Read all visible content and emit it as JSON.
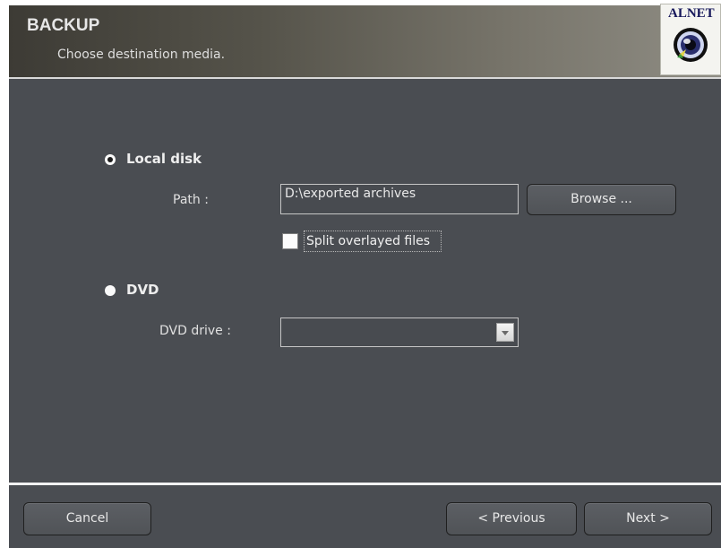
{
  "header": {
    "title": "BACKUP",
    "subtitle": "Choose destination media.",
    "logo_text": "ALNET"
  },
  "options": {
    "local_disk": {
      "label": "Local disk",
      "selected": true
    },
    "dvd": {
      "label": "DVD",
      "selected": false
    }
  },
  "local": {
    "path_label": "Path :",
    "path_value": "D:\\exported archives",
    "browse_label": "Browse ...",
    "split_label": "Split overlayed files",
    "split_checked": false
  },
  "dvd": {
    "drive_label": "DVD drive :",
    "drive_value": ""
  },
  "footer": {
    "cancel_label": "Cancel",
    "previous_label": "< Previous",
    "next_label": "Next >"
  },
  "colors": {
    "panel_bg": "#4a4d52",
    "header_gradient_start": "#3d3b35",
    "header_gradient_end": "#8f8d84",
    "logo_text": "#16175a"
  }
}
